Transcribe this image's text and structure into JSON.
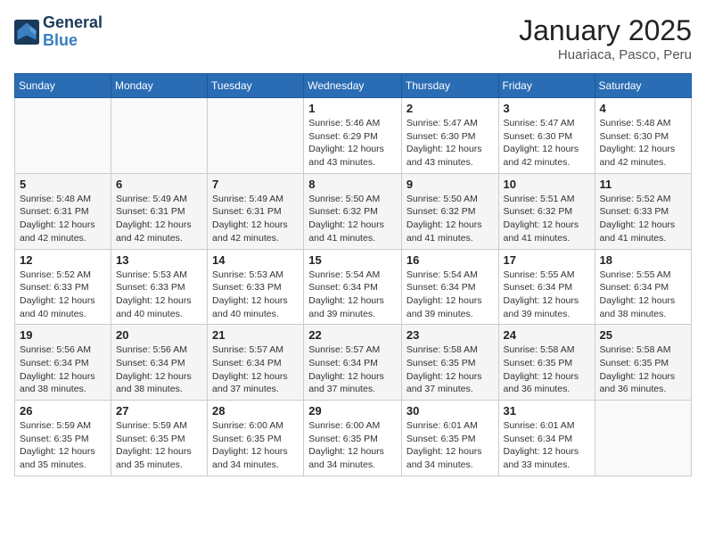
{
  "logo": {
    "line1": "General",
    "line2": "Blue"
  },
  "title": "January 2025",
  "subtitle": "Huariaca, Pasco, Peru",
  "weekdays": [
    "Sunday",
    "Monday",
    "Tuesday",
    "Wednesday",
    "Thursday",
    "Friday",
    "Saturday"
  ],
  "weeks": [
    [
      {
        "day": "",
        "info": ""
      },
      {
        "day": "",
        "info": ""
      },
      {
        "day": "",
        "info": ""
      },
      {
        "day": "1",
        "info": "Sunrise: 5:46 AM\nSunset: 6:29 PM\nDaylight: 12 hours\nand 43 minutes."
      },
      {
        "day": "2",
        "info": "Sunrise: 5:47 AM\nSunset: 6:30 PM\nDaylight: 12 hours\nand 43 minutes."
      },
      {
        "day": "3",
        "info": "Sunrise: 5:47 AM\nSunset: 6:30 PM\nDaylight: 12 hours\nand 42 minutes."
      },
      {
        "day": "4",
        "info": "Sunrise: 5:48 AM\nSunset: 6:30 PM\nDaylight: 12 hours\nand 42 minutes."
      }
    ],
    [
      {
        "day": "5",
        "info": "Sunrise: 5:48 AM\nSunset: 6:31 PM\nDaylight: 12 hours\nand 42 minutes."
      },
      {
        "day": "6",
        "info": "Sunrise: 5:49 AM\nSunset: 6:31 PM\nDaylight: 12 hours\nand 42 minutes."
      },
      {
        "day": "7",
        "info": "Sunrise: 5:49 AM\nSunset: 6:31 PM\nDaylight: 12 hours\nand 42 minutes."
      },
      {
        "day": "8",
        "info": "Sunrise: 5:50 AM\nSunset: 6:32 PM\nDaylight: 12 hours\nand 41 minutes."
      },
      {
        "day": "9",
        "info": "Sunrise: 5:50 AM\nSunset: 6:32 PM\nDaylight: 12 hours\nand 41 minutes."
      },
      {
        "day": "10",
        "info": "Sunrise: 5:51 AM\nSunset: 6:32 PM\nDaylight: 12 hours\nand 41 minutes."
      },
      {
        "day": "11",
        "info": "Sunrise: 5:52 AM\nSunset: 6:33 PM\nDaylight: 12 hours\nand 41 minutes."
      }
    ],
    [
      {
        "day": "12",
        "info": "Sunrise: 5:52 AM\nSunset: 6:33 PM\nDaylight: 12 hours\nand 40 minutes."
      },
      {
        "day": "13",
        "info": "Sunrise: 5:53 AM\nSunset: 6:33 PM\nDaylight: 12 hours\nand 40 minutes."
      },
      {
        "day": "14",
        "info": "Sunrise: 5:53 AM\nSunset: 6:33 PM\nDaylight: 12 hours\nand 40 minutes."
      },
      {
        "day": "15",
        "info": "Sunrise: 5:54 AM\nSunset: 6:34 PM\nDaylight: 12 hours\nand 39 minutes."
      },
      {
        "day": "16",
        "info": "Sunrise: 5:54 AM\nSunset: 6:34 PM\nDaylight: 12 hours\nand 39 minutes."
      },
      {
        "day": "17",
        "info": "Sunrise: 5:55 AM\nSunset: 6:34 PM\nDaylight: 12 hours\nand 39 minutes."
      },
      {
        "day": "18",
        "info": "Sunrise: 5:55 AM\nSunset: 6:34 PM\nDaylight: 12 hours\nand 38 minutes."
      }
    ],
    [
      {
        "day": "19",
        "info": "Sunrise: 5:56 AM\nSunset: 6:34 PM\nDaylight: 12 hours\nand 38 minutes."
      },
      {
        "day": "20",
        "info": "Sunrise: 5:56 AM\nSunset: 6:34 PM\nDaylight: 12 hours\nand 38 minutes."
      },
      {
        "day": "21",
        "info": "Sunrise: 5:57 AM\nSunset: 6:34 PM\nDaylight: 12 hours\nand 37 minutes."
      },
      {
        "day": "22",
        "info": "Sunrise: 5:57 AM\nSunset: 6:34 PM\nDaylight: 12 hours\nand 37 minutes."
      },
      {
        "day": "23",
        "info": "Sunrise: 5:58 AM\nSunset: 6:35 PM\nDaylight: 12 hours\nand 37 minutes."
      },
      {
        "day": "24",
        "info": "Sunrise: 5:58 AM\nSunset: 6:35 PM\nDaylight: 12 hours\nand 36 minutes."
      },
      {
        "day": "25",
        "info": "Sunrise: 5:58 AM\nSunset: 6:35 PM\nDaylight: 12 hours\nand 36 minutes."
      }
    ],
    [
      {
        "day": "26",
        "info": "Sunrise: 5:59 AM\nSunset: 6:35 PM\nDaylight: 12 hours\nand 35 minutes."
      },
      {
        "day": "27",
        "info": "Sunrise: 5:59 AM\nSunset: 6:35 PM\nDaylight: 12 hours\nand 35 minutes."
      },
      {
        "day": "28",
        "info": "Sunrise: 6:00 AM\nSunset: 6:35 PM\nDaylight: 12 hours\nand 34 minutes."
      },
      {
        "day": "29",
        "info": "Sunrise: 6:00 AM\nSunset: 6:35 PM\nDaylight: 12 hours\nand 34 minutes."
      },
      {
        "day": "30",
        "info": "Sunrise: 6:01 AM\nSunset: 6:35 PM\nDaylight: 12 hours\nand 34 minutes."
      },
      {
        "day": "31",
        "info": "Sunrise: 6:01 AM\nSunset: 6:34 PM\nDaylight: 12 hours\nand 33 minutes."
      },
      {
        "day": "",
        "info": ""
      }
    ]
  ]
}
